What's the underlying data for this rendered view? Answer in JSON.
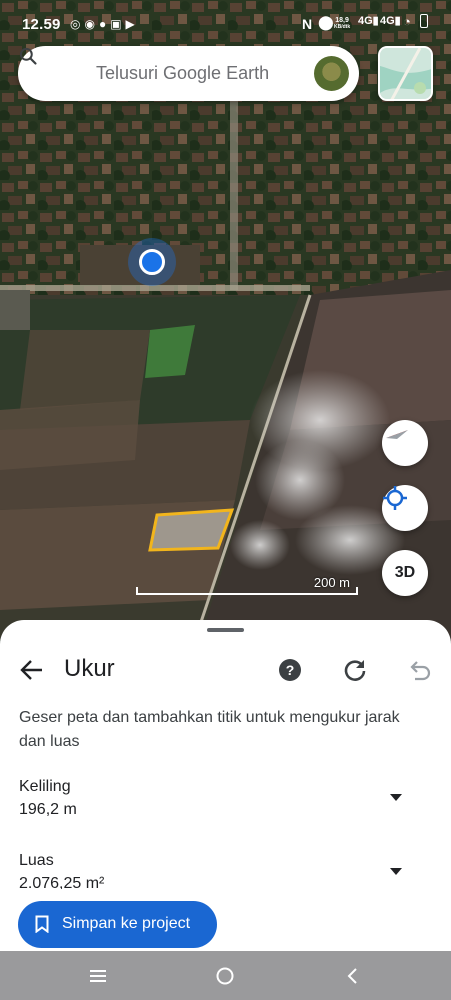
{
  "status_bar": {
    "time": "12.59",
    "net_speed": "18,9",
    "net_unit": "KB/dtk"
  },
  "search": {
    "placeholder": "Telusuri Google Earth"
  },
  "map": {
    "scale_label": "200 m",
    "view_3d_label": "3D"
  },
  "measure": {
    "title": "Ukur",
    "instruction": "Geser peta dan tambahkan titik untuk mengukur jarak dan luas",
    "perimeter": {
      "label": "Keliling",
      "value": "196,2 m"
    },
    "area": {
      "label": "Luas",
      "value": "2.076,25 m²"
    },
    "save_label": "Simpan ke project"
  },
  "colors": {
    "accent": "#1a67d2",
    "polygon_outline": "#f2b51c",
    "location_dot": "#1a73e8"
  },
  "icons": [
    "search-icon",
    "back-arrow-icon",
    "help-icon",
    "refresh-icon",
    "undo-icon",
    "compass-icon",
    "my-location-icon",
    "bookmark-icon",
    "chevron-down-icon"
  ]
}
